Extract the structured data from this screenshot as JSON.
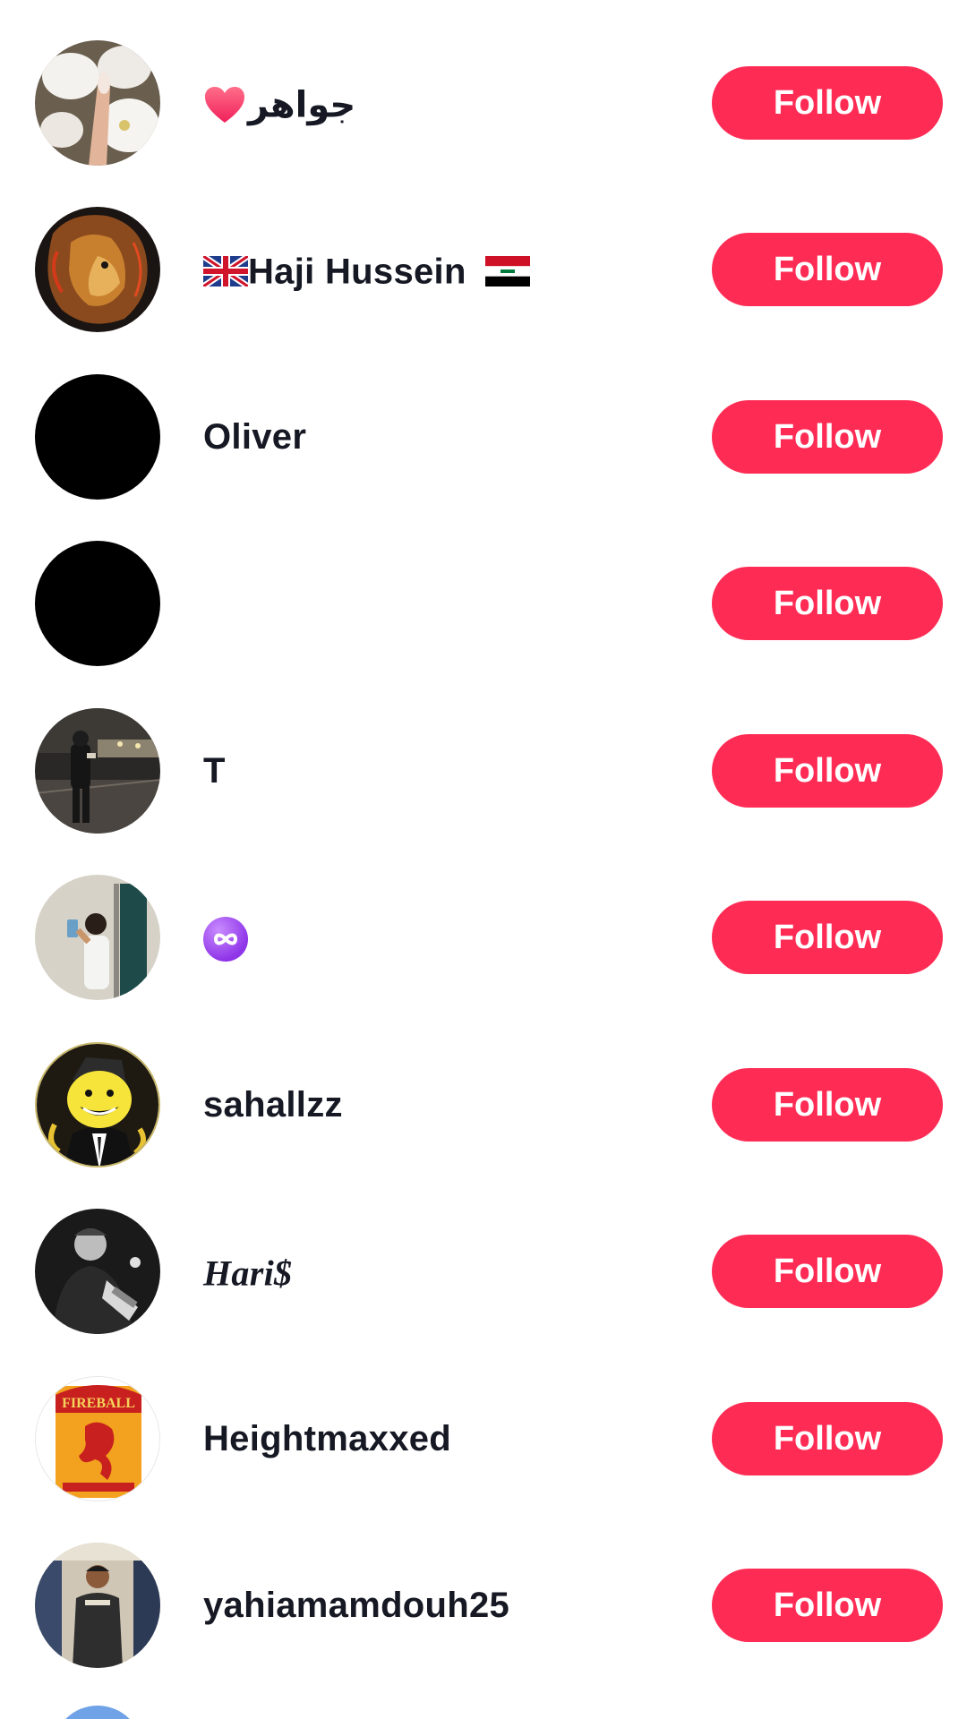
{
  "follow_label": "Follow",
  "accent_color": "#fe2c55",
  "users": [
    {
      "name": "جواهر",
      "avatar": "orchid-hand-photo",
      "pre_emoji": "red-heart-icon"
    },
    {
      "name": "Haji Hussein",
      "avatar": "lion-artwork-photo",
      "pre_emoji": "uk-flag-icon",
      "post_emoji": "iraq-flag-icon"
    },
    {
      "name": "Oliver",
      "avatar": "black-circle"
    },
    {
      "name": "",
      "avatar": "black-circle"
    },
    {
      "name": "T",
      "avatar": "night-street-photo"
    },
    {
      "name": "",
      "avatar": "mirror-selfie-photo",
      "pre_emoji": "infinity-icon"
    },
    {
      "name": "sahallzz",
      "avatar": "koro-sensei-cartoon"
    },
    {
      "name": "Hari$",
      "avatar": "bw-portrait-photo"
    },
    {
      "name": "Heightmaxxed",
      "avatar": "fireball-label-logo"
    },
    {
      "name": "yahiamamdouh25",
      "avatar": "standing-man-photo"
    }
  ]
}
